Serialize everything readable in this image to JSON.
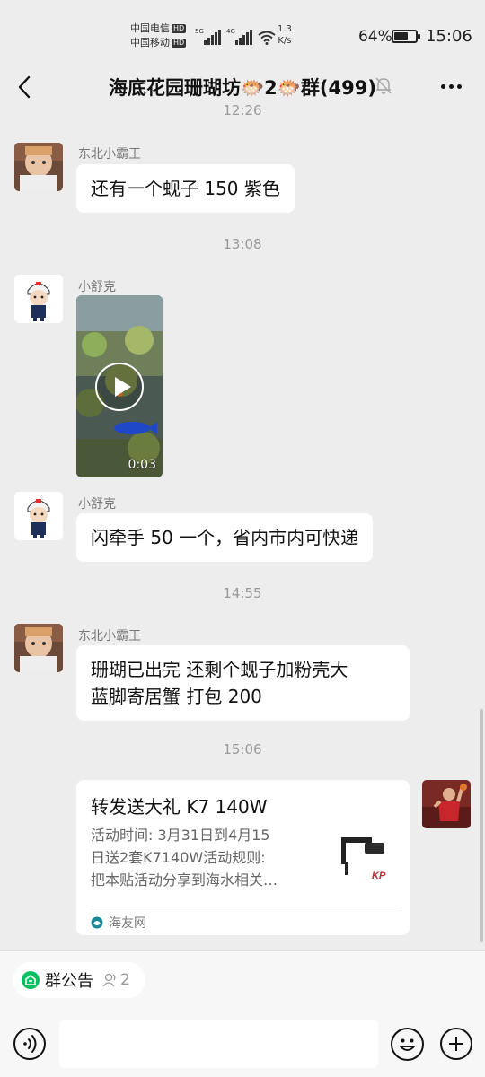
{
  "status_bar": {
    "carrier_1": "中国电信",
    "carrier_2": "中国移动",
    "hd_badge": "HD",
    "net_1": "5G",
    "net_2": "4G",
    "speed_value": "1.3",
    "speed_unit": "K/s",
    "battery_percent": "64%",
    "battery_level": 0.64,
    "time": "15:06"
  },
  "header": {
    "title": "海底花园珊瑚坊🐡2🐡群(499)",
    "icons": [
      "back-arrow-icon",
      "mute-bell-icon",
      "more-dots-icon"
    ]
  },
  "chat": {
    "partial_time": "12:26",
    "messages": [
      {
        "sender": "东北小霸王",
        "text": "还有一个蚬子 150 紫色"
      },
      {
        "time": "13:08"
      },
      {
        "sender": "小舒克",
        "video_duration": "0:03"
      },
      {
        "sender": "小舒克",
        "text": "闪牵手 50 一个，省内市内可快递"
      },
      {
        "time": "14:55"
      },
      {
        "sender": "东北小霸王",
        "line_1": "珊瑚已出完  还剩个蚬子加粉壳大",
        "line_2": "蓝脚寄居蟹 打包 200"
      },
      {
        "time": "15:06"
      }
    ],
    "share_card": {
      "title": "转发送大礼 K7 140W",
      "desc": "活动时间:  3月31日到4月15\n日送2套K7140W活动规则:\n把本贴活动分享到海水相关…",
      "source": "海友网",
      "thumb_logo": "KP"
    }
  },
  "bottom": {
    "notice_label": "群公告",
    "notice_count": "2",
    "input_value": "",
    "icons": [
      "voice-icon",
      "emoji-icon",
      "plus-icon"
    ]
  },
  "colors": {
    "background": "#ededed",
    "bubble": "#ffffff",
    "accent_green": "#07c160",
    "muted_text": "#999999"
  }
}
